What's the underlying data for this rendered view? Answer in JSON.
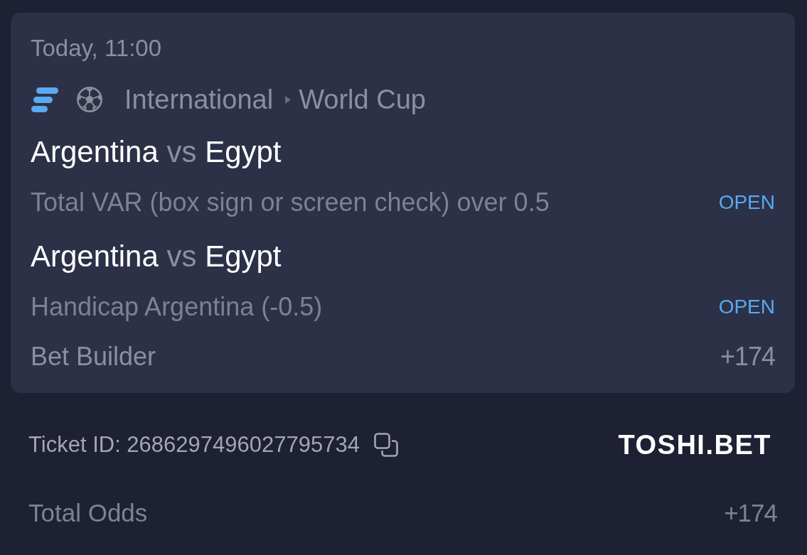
{
  "bet_card": {
    "time": "Today, 11:00",
    "competition": {
      "region": "International",
      "league": "World Cup"
    },
    "selections": [
      {
        "home": "Argentina",
        "separator": "vs",
        "away": "Egypt",
        "market": "Total VAR (box sign or screen check) over 0.5",
        "status": "OPEN"
      },
      {
        "home": "Argentina",
        "separator": "vs",
        "away": "Egypt",
        "market": "Handicap Argentina (-0.5)",
        "status": "OPEN"
      }
    ],
    "bet_type": "Bet Builder",
    "odds": "+174"
  },
  "ticket": {
    "id_text": "Ticket ID: 2686297496027795734"
  },
  "brand": "TOSHI.BET",
  "total": {
    "label": "Total Odds",
    "value": "+174"
  }
}
